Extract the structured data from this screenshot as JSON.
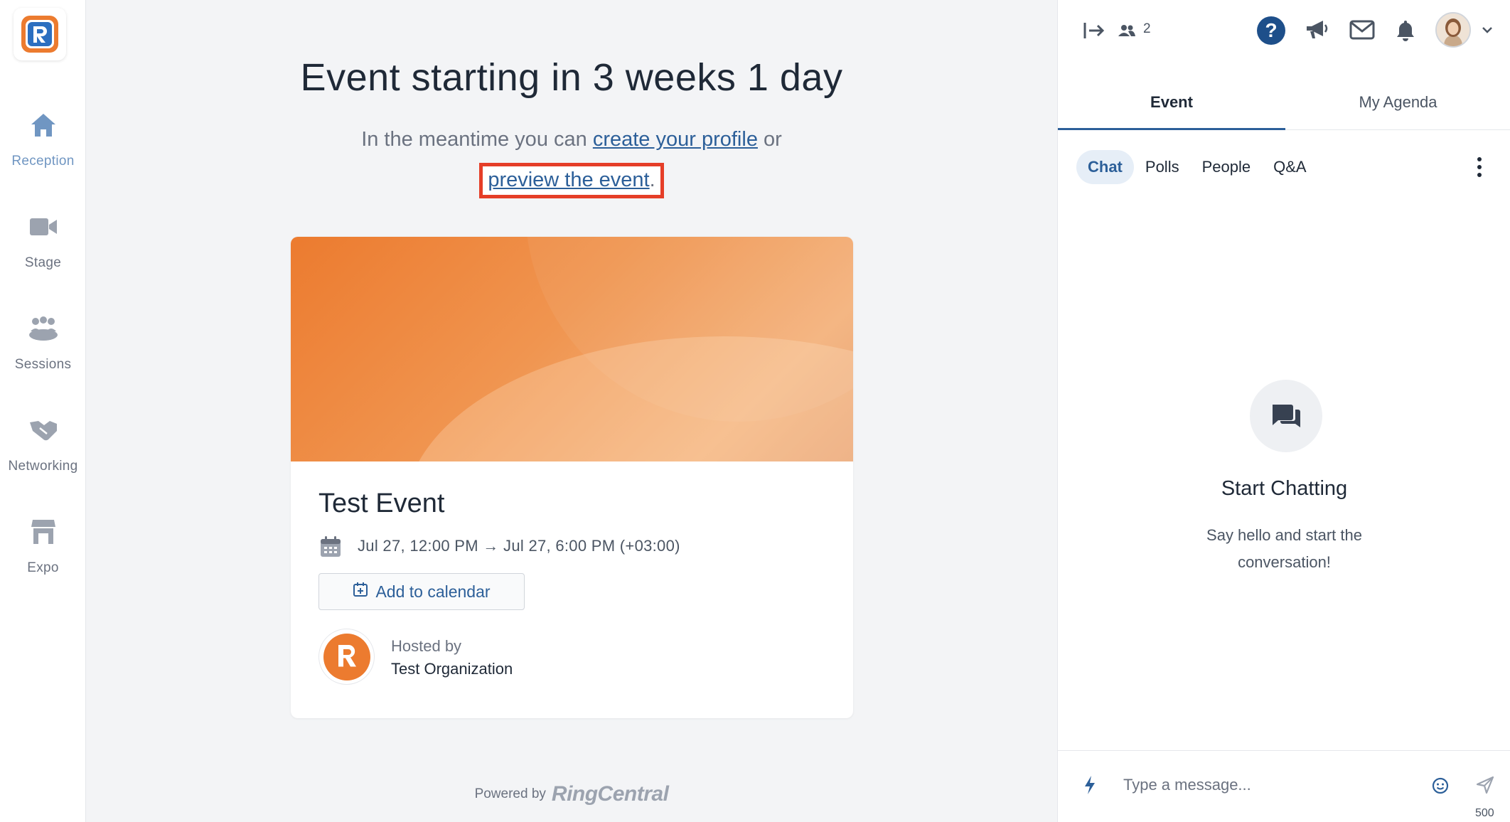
{
  "sidebar": {
    "items": [
      {
        "label": "Reception",
        "icon": "home-icon",
        "active": true
      },
      {
        "label": "Stage",
        "icon": "video-camera-icon",
        "active": false
      },
      {
        "label": "Sessions",
        "icon": "people-group-icon",
        "active": false
      },
      {
        "label": "Networking",
        "icon": "handshake-icon",
        "active": false
      },
      {
        "label": "Expo",
        "icon": "store-booth-icon",
        "active": false
      }
    ]
  },
  "main": {
    "headline": "Event starting in 3 weeks 1 day",
    "sub_prefix": "In the meantime you can ",
    "create_profile_link": "create your profile",
    "sub_or": " or",
    "preview_link": "preview the event",
    "preview_period": "."
  },
  "event_card": {
    "title": "Test Event",
    "datetime": "Jul 27, 12:00 PM → Jul 27, 6:00 PM (+03:00)",
    "add_calendar_label": "Add to calendar",
    "hosted_by_label": "Hosted by",
    "host_name": "Test Organization"
  },
  "footer": {
    "powered_by": "Powered by",
    "brand": "RingCentral"
  },
  "right_panel": {
    "attendee_count": "2",
    "tabs": [
      "Event",
      "My Agenda"
    ],
    "subtabs": [
      "Chat",
      "Polls",
      "People",
      "Q&A"
    ],
    "empty_title": "Start Chatting",
    "empty_text": "Say hello and start the conversation!",
    "message_placeholder": "Type a message...",
    "char_limit": "500"
  },
  "colors": {
    "accent_blue": "#2c5f99",
    "brand_orange": "#ec7b2f",
    "highlight_red": "#e53e28"
  }
}
